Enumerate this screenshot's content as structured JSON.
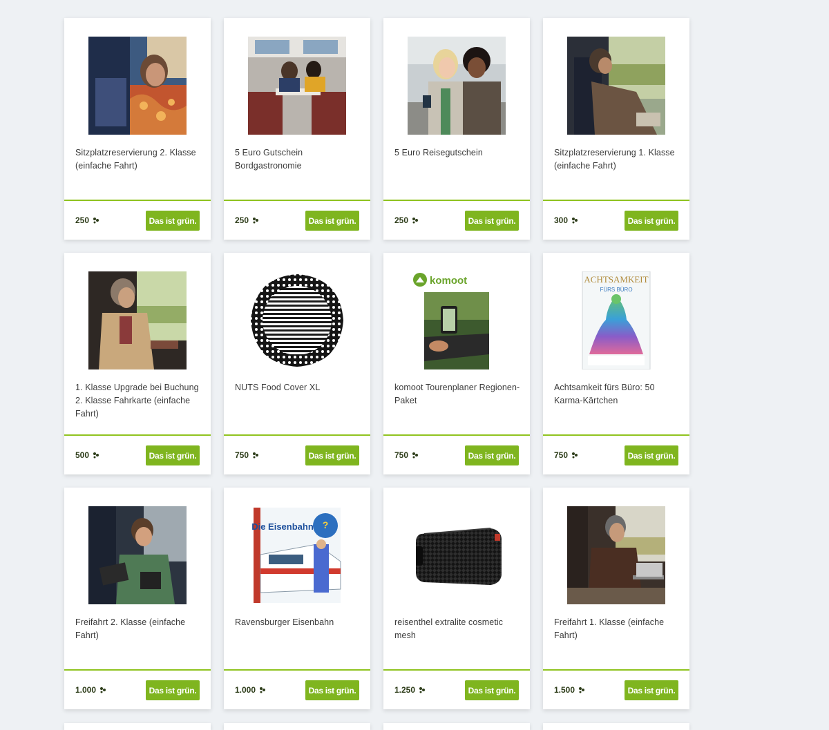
{
  "action_label": "Das ist grün.",
  "points_icon": "leaf-points-icon",
  "colors": {
    "accent": "#7fb51f",
    "divider": "#8fc31f",
    "background": "#eef1f4"
  },
  "products": [
    {
      "title": "Sitzplatzreservierung 2. Klasse (einfache Fahrt)",
      "price": "250",
      "image": "woman-on-train-photo"
    },
    {
      "title": "5 Euro Gutschein Bordgastronomie",
      "price": "250",
      "image": "dining-car-photo"
    },
    {
      "title": "5 Euro Reisegutschein",
      "price": "250",
      "image": "travelers-with-phone-photo"
    },
    {
      "title": "Sitzplatzreservierung 1. Klasse (einfache Fahrt)",
      "price": "300",
      "image": "man-relaxing-on-train-photo"
    },
    {
      "title": "1. Klasse Upgrade bei Buchung 2. Klasse Fahrkarte (einfache Fahrt)",
      "price": "500",
      "image": "woman-reading-on-train-photo"
    },
    {
      "title": "NUTS Food Cover XL",
      "price": "750",
      "image": "food-cover-photo"
    },
    {
      "title": "komoot Tourenplaner Regionen-Paket",
      "price": "750",
      "image": "komoot-bike-photo",
      "logo_text": "komoot"
    },
    {
      "title": "Achtsamkeit fürs Büro: 50 Karma-Kärtchen",
      "price": "750",
      "image": "achtsamkeit-book-cover",
      "cover_title": "ACHTSAMKEIT",
      "cover_subtitle": "FÜRS BÜRO"
    },
    {
      "title": "Freifahrt 2. Klasse (einfache Fahrt)",
      "price": "1.000",
      "image": "young-man-with-tablet-photo"
    },
    {
      "title": "Ravensburger Eisenbahn",
      "price": "1.000",
      "image": "eisenbahn-book-cover",
      "cover_title": "Die Eisenbahn"
    },
    {
      "title": "reisenthel extralite cosmetic mesh",
      "price": "1.250",
      "image": "cosmetic-bag-photo"
    },
    {
      "title": "Freifahrt 1. Klasse (einfache Fahrt)",
      "price": "1.500",
      "image": "man-with-laptop-photo"
    }
  ]
}
